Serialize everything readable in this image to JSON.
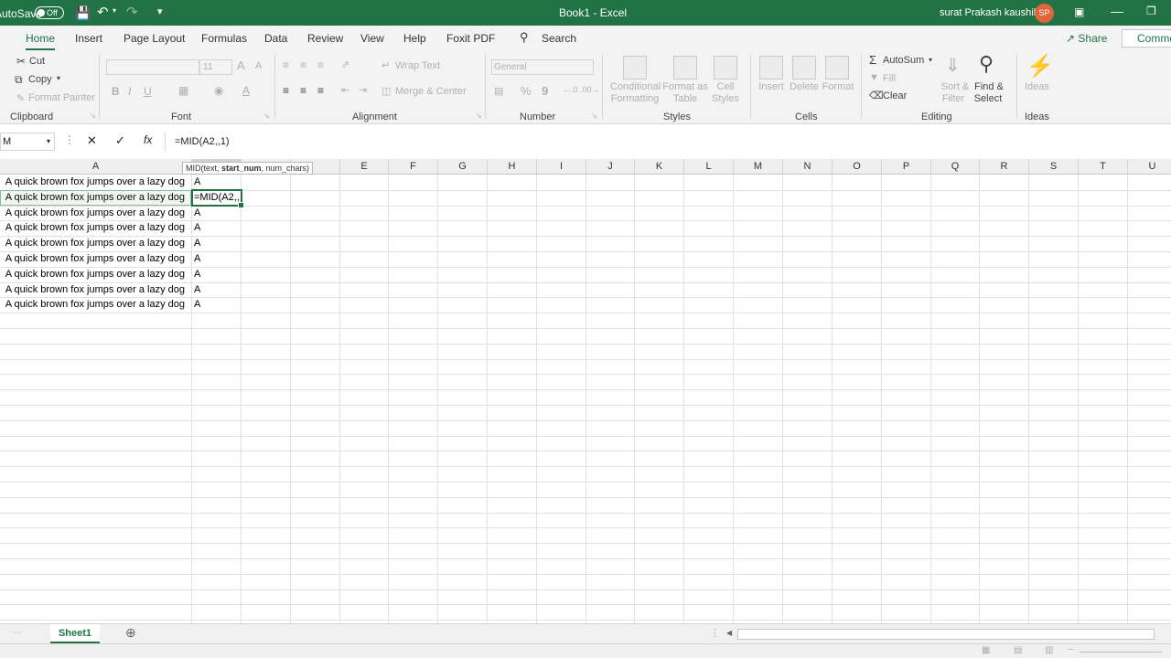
{
  "titlebar": {
    "autosave_label": "AutoSave",
    "autosave_state": "Off",
    "document_title": "Book1 - Excel",
    "user_name": "surat Prakash kaushik",
    "user_initials": "SP"
  },
  "tabs": [
    "Home",
    "Insert",
    "Page Layout",
    "Formulas",
    "Data",
    "Review",
    "View",
    "Help",
    "Foxit PDF"
  ],
  "search": {
    "label": "Search"
  },
  "share_label": "Share",
  "comments_label": "Comme",
  "ribbon": {
    "clipboard": {
      "cut": "Cut",
      "copy": "Copy",
      "format_painter": "Format Painter",
      "label": "Clipboard"
    },
    "font": {
      "size": "11",
      "bold": "B",
      "italic": "I",
      "underline": "U",
      "label": "Font",
      "grow": "A",
      "shrink": "A",
      "font_color": "A"
    },
    "alignment": {
      "wrap_text": "Wrap Text",
      "merge_center": "Merge & Center",
      "label": "Alignment"
    },
    "number": {
      "format": "General",
      "percent": "%",
      "comma": "9",
      "label": "Number"
    },
    "styles": {
      "conditional": [
        "Conditional",
        "Formatting"
      ],
      "format_table": [
        "Format as",
        "Table"
      ],
      "cell_styles": [
        "Cell",
        "Styles"
      ],
      "label": "Styles"
    },
    "cells": {
      "insert": "Insert",
      "delete": "Delete",
      "format": "Format",
      "label": "Cells"
    },
    "editing": {
      "autosum": "AutoSum",
      "fill": "Fill",
      "clear": "Clear",
      "sort_filter": [
        "Sort &",
        "Filter"
      ],
      "find_select": [
        "Find &",
        "Select"
      ],
      "label": "Editing"
    },
    "ideas": {
      "button": "Ideas",
      "label": "Ideas"
    }
  },
  "formula_bar": {
    "name_box": "M",
    "formula": "=MID(A2,,1)"
  },
  "columns": [
    "A",
    "",
    "",
    "",
    "E",
    "F",
    "G",
    "H",
    "I",
    "J",
    "K",
    "L",
    "M",
    "N",
    "O",
    "P",
    "Q",
    "R",
    "S",
    "T",
    "U"
  ],
  "rows": [
    {
      "a": "A quick brown fox jumps over a lazy dog",
      "b": "A"
    },
    {
      "a": "A quick brown fox jumps over a lazy dog",
      "b": "=MID(A2,,"
    },
    {
      "a": "A quick brown fox jumps over a lazy dog",
      "b": "A"
    },
    {
      "a": "A quick brown fox jumps over a lazy dog",
      "b": "A"
    },
    {
      "a": "A quick brown fox jumps over a lazy dog",
      "b": "A"
    },
    {
      "a": "A quick brown fox jumps over a lazy dog",
      "b": "A"
    },
    {
      "a": "A quick brown fox jumps over a lazy dog",
      "b": "A"
    },
    {
      "a": "A quick brown fox jumps over a lazy dog",
      "b": "A"
    },
    {
      "a": "A quick brown fox jumps over a lazy dog",
      "b": "A"
    }
  ],
  "tooltip": {
    "prefix": "MID(text, ",
    "bold": "start_num",
    "suffix": ", num_chars)"
  },
  "sheet_tab": "Sheet1",
  "accent_color": "#217346"
}
